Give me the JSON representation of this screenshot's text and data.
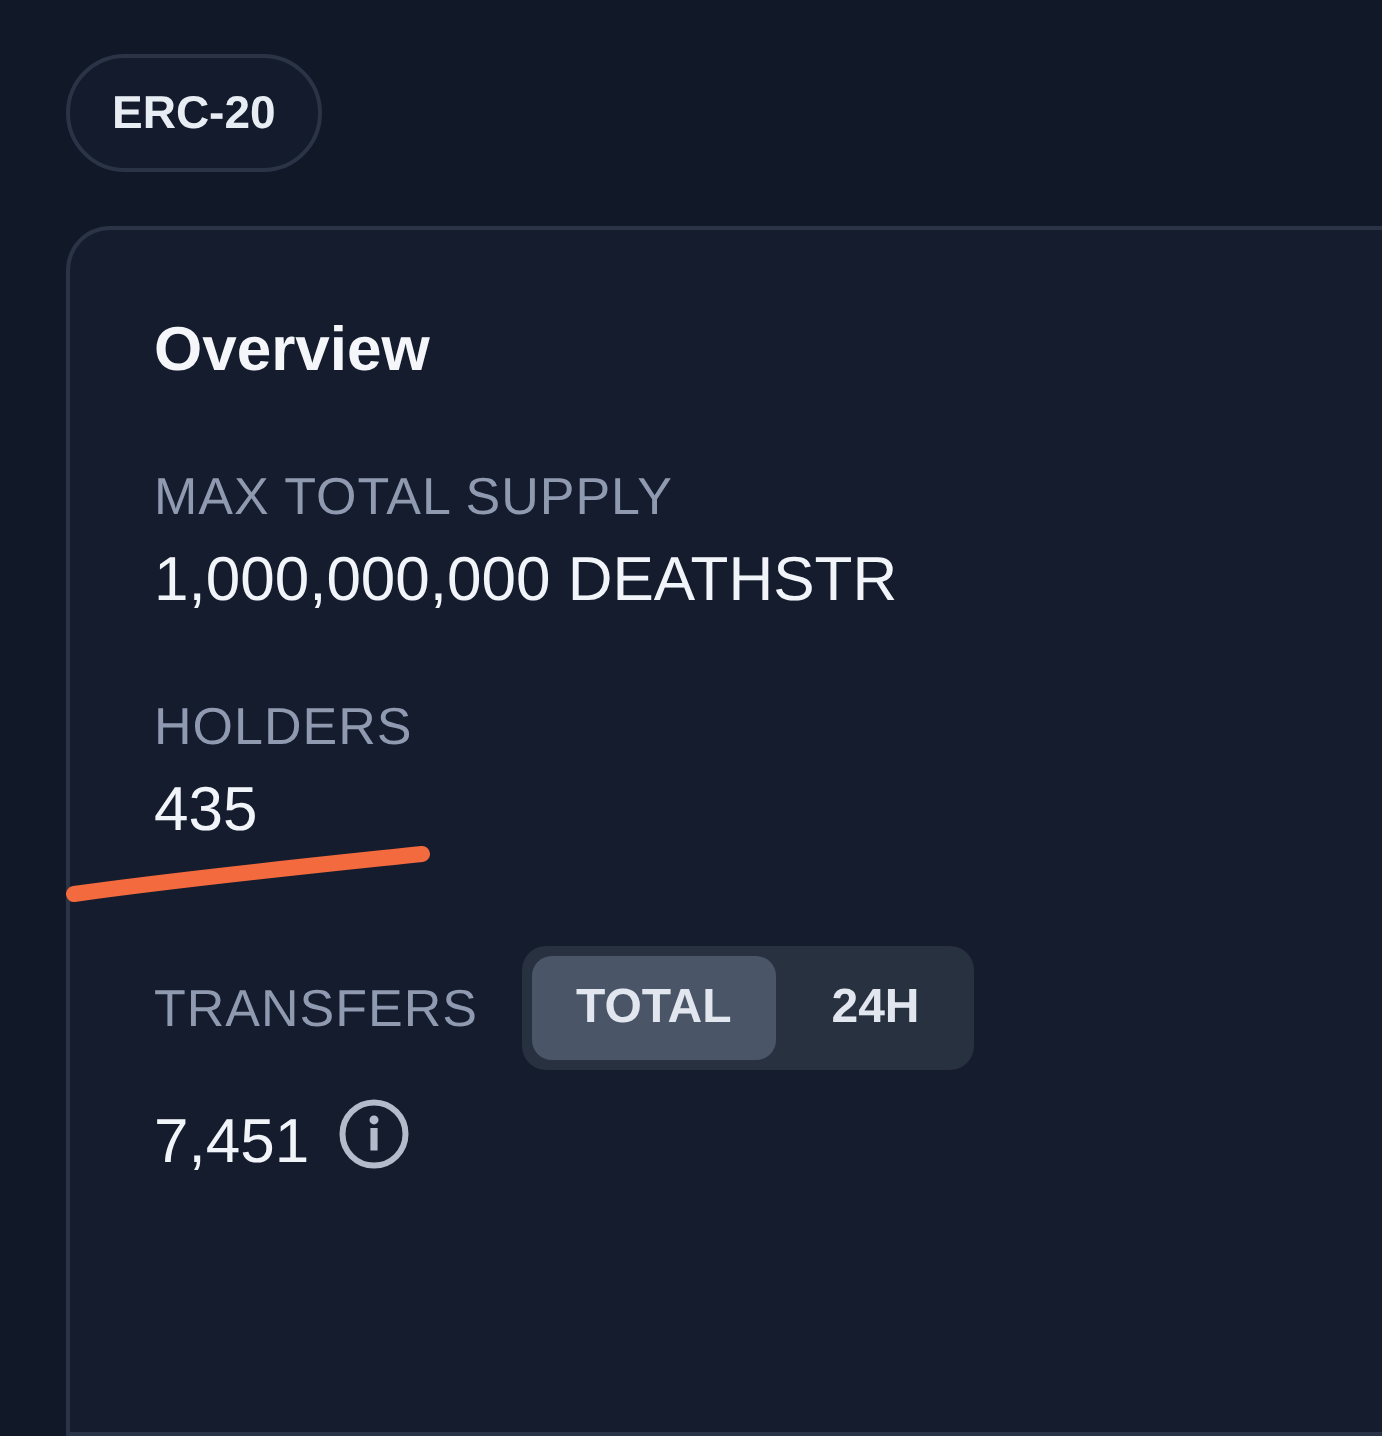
{
  "badge": "ERC-20",
  "overview": {
    "title": "Overview",
    "fields": [
      {
        "kind": "plain",
        "label": "MAX TOTAL SUPPLY",
        "value": "1,000,000,000 DEATHSTR"
      },
      {
        "kind": "plain",
        "label": "HOLDERS",
        "value": "435"
      },
      {
        "kind": "toggle",
        "label": "TRANSFERS",
        "value": "7,451",
        "options": [
          {
            "label": "TOTAL",
            "selected": true
          },
          {
            "label": "24H",
            "selected": false
          }
        ]
      }
    ]
  }
}
